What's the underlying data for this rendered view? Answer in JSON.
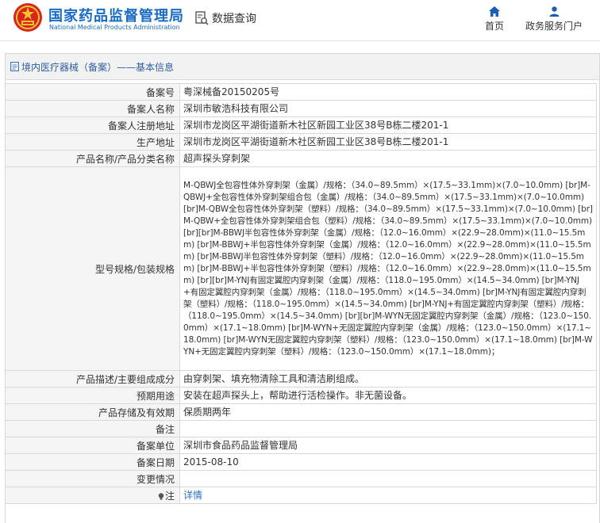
{
  "header": {
    "brand_cn": "国家药品监督管理局",
    "brand_en": "National Medical Products Administration",
    "query_label": "数据查询",
    "nav": [
      {
        "label": "首页",
        "icon": "home-icon"
      },
      {
        "label": "政务服务门户",
        "icon": "user-icon"
      }
    ]
  },
  "panel": {
    "title": "境内医疗器械（备案）——基本信息"
  },
  "fields": [
    {
      "label": "备案号",
      "value": "粤深械备20150205号"
    },
    {
      "label": "备案人名称",
      "value": "深圳市敏浩科技有限公司"
    },
    {
      "label": "备案人注册地址",
      "value": "深圳市龙岗区平湖街道新木社区新园工业区38号B栋二楼201-1"
    },
    {
      "label": "生产地址",
      "value": "深圳市龙岗区平湖街道新木社区新园工业区38号B栋二楼201-1"
    },
    {
      "label": "产品名称/产品分类名称",
      "value": "超声探头穿刺架"
    },
    {
      "label": "型号规格/包装规格",
      "value": "M-QBWJ全包容性体外穿刺架（金属）/规格：（34.0~89.5mm）×(17.5~33.1mm)×(7.0~10.0mm) [br]M-QBWJ+全包容性体外穿刺架组合包（金属）/规格：（34.0~89.5mm）×(17.5~33.1mm)×(7.0~10.0mm) [br]M-QBW全包容性体外穿刺架（塑料）/规格：（34.0~89.5mm）×(17.5~33.1mm)×(7.0~10.0mm) [br]M-QBW+全包容性体外穿刺架组合包（塑料）/规格：（34.0~89.5mm）×(17.5~33.1mm)×(7.0~10.0mm) [br][br]M-BBWJ半包容性体外穿刺架（金属）/规格：（12.0~16.0mm）×(22.9~28.0mm)×(11.0~15.5mm) [br]M-BBWJ+半包容性体外穿刺架（金属）/规格：（12.0~16.0mm）×(22.9~28.0mm)×(11.0~15.5mm) [br]M-BBWJ半包容性体外穿刺架（塑料）/规格：（12.0~16.0mm）×(22.9~28.0mm)×(11.0~15.5mm) [br]M-BBWJ+半包容性体外穿刺架（塑料）/规格：（12.0~16.0mm）×(22.9~28.0mm)×(11.0~15.5mm) [br][br]M-YNJ有固定翼腔内穿刺架（金属）/规格：（118.0~195.0mm）×(14.5~34.0mm) [br]M-YNJ+有固定翼腔内穿刺架（金属）/规格：（118.0~195.0mm）×(14.5~34.0mm) [br]M-YNJ有固定翼腔内穿刺架（塑料）/规格：（118.0~195.0mm）×(14.5~34.0mm) [br]M-YNJ+有固定翼腔内穿刺架（塑料）/规格：（118.0~195.0mm）×(14.5~34.0mm) [br][br]M-WYN无固定翼腔内穿刺架（金属）/规格：（123.0~150.0mm）×(17.1~18.0mm) [br]M-WYN+无固定翼腔内穿刺架（金属）/规格：（123.0~150.0mm）×(17.1~18.0mm) [br]M-WYN无固定翼腔内穿刺架（塑料）/规格：（123.0~150.0mm）×(17.1~18.0mm) [br]M-WYN+无固定翼腔内穿刺架（塑料）/规格：（123.0~150.0mm）×(17.1~18.0mm)；"
    },
    {
      "label": "产品描述/主要组成成分",
      "value": "由穿刺架、填充物清除工具和清洁刷组成。"
    },
    {
      "label": "预期用途",
      "value": "安装在超声探头上，帮助进行活检操作。非无菌设备。"
    },
    {
      "label": "产品存储及有效期",
      "value": "保质期两年"
    },
    {
      "label": "备注",
      "value": ""
    },
    {
      "label": "备案单位",
      "value": "深圳市食品药品监督管理局"
    },
    {
      "label": "备案日期",
      "value": "2015-08-10"
    },
    {
      "label": "变更情况",
      "value": ""
    },
    {
      "label": "注",
      "value": "详情",
      "icon": "lightbulb-icon",
      "link": true
    }
  ],
  "colors": {
    "brand": "#1a6bc4",
    "link": "#2a6fc9",
    "title": "#2f5f9e"
  }
}
